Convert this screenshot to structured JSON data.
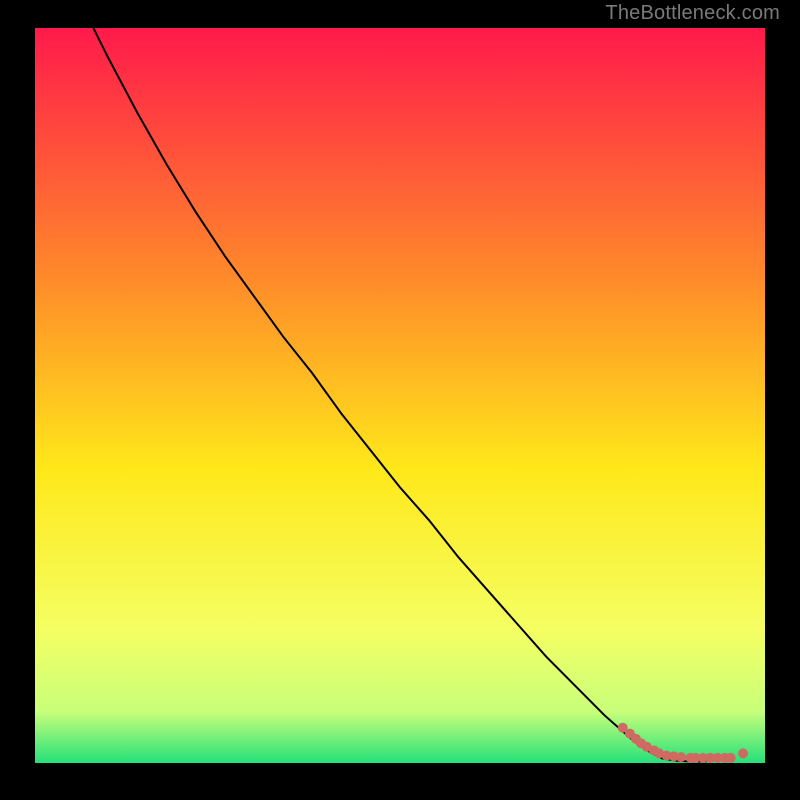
{
  "attribution": "TheBottleneck.com",
  "colors": {
    "background_frame": "#000000",
    "attribution_text": "#7a7a7a",
    "gradient_top": "#ff1a4b",
    "gradient_mid1": "#ff8a2a",
    "gradient_mid2": "#ffe81a",
    "gradient_mid3": "#f4ff63",
    "gradient_mid4": "#c8ff7a",
    "gradient_bottom": "#25e07a",
    "curve": "#000000",
    "scatter": "#cf6a63"
  },
  "chart_data": {
    "type": "line",
    "title": "",
    "xlabel": "",
    "ylabel": "",
    "xlim": [
      0,
      100
    ],
    "ylim": [
      0,
      100
    ],
    "series": [
      {
        "name": "curve",
        "kind": "line",
        "x": [
          8,
          10,
          14,
          18,
          22,
          26,
          30,
          34,
          38,
          42,
          46,
          50,
          54,
          58,
          62,
          66,
          70,
          74,
          78,
          82,
          84.5,
          86,
          88,
          90,
          92
        ],
        "y": [
          100,
          96,
          88.5,
          81.5,
          75,
          69,
          63.5,
          58,
          53,
          47.5,
          42.5,
          37.5,
          33,
          28,
          23.5,
          19,
          14.5,
          10.5,
          6.5,
          3,
          1.3,
          0.6,
          0.3,
          0.2,
          0.2
        ]
      },
      {
        "name": "points",
        "kind": "scatter",
        "x": [
          80.5,
          81.5,
          82.3,
          83,
          83.8,
          84.8,
          85.5,
          86.5,
          87.5,
          88.5,
          89.8,
          90.5,
          91.5,
          92.5,
          93.5,
          94.5,
          95.3,
          97
        ],
        "y": [
          4.8,
          4.0,
          3.3,
          2.7,
          2.2,
          1.7,
          1.3,
          1.0,
          0.9,
          0.8,
          0.7,
          0.7,
          0.7,
          0.7,
          0.7,
          0.7,
          0.7,
          1.3
        ]
      }
    ]
  }
}
